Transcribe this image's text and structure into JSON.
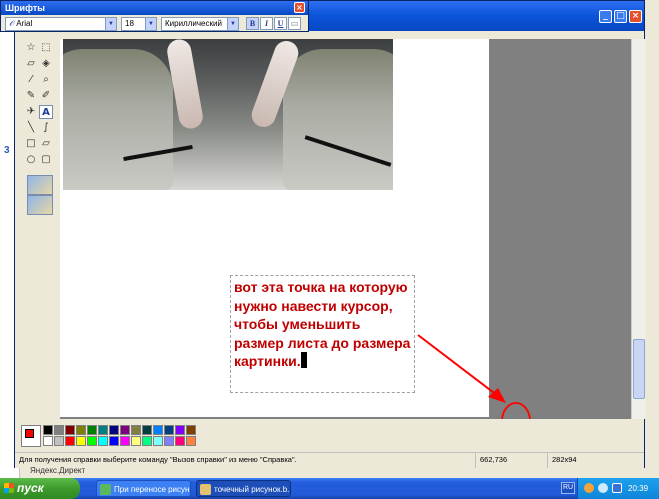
{
  "font_toolbar": {
    "title": "Шрифты",
    "font_name": "Arial",
    "font_size": "18",
    "script": "Кириллический",
    "bold_label": "B",
    "italic_label": "I",
    "underline_label": "U"
  },
  "canvas": {
    "annotation_text": "вот эта точка на которую нужно навести курсор, чтобы уменьшить размер листа до размера картинки.",
    "annotation_color": "#c00000",
    "arrow_color": "#ff0000"
  },
  "palette": {
    "foreground": "#ff0000",
    "background": "#ffffff",
    "colors": [
      "#000000",
      "#808080",
      "#800000",
      "#808000",
      "#008000",
      "#008080",
      "#000080",
      "#800080",
      "#808040",
      "#004040",
      "#0080ff",
      "#004080",
      "#8000ff",
      "#804000",
      "#ffffff",
      "#c0c0c0",
      "#ff0000",
      "#ffff00",
      "#00ff00",
      "#00ffff",
      "#0000ff",
      "#ff00ff",
      "#ffff80",
      "#00ff80",
      "#80ffff",
      "#8080ff",
      "#ff0080",
      "#ff8040"
    ]
  },
  "statusbar": {
    "help": "Для получения справки выберите команду \"Вызов справки\" из меню \"Справка\".",
    "cursor": "662,736",
    "size": "282x94"
  },
  "background_window": {
    "left_marker": "3",
    "bottom_text": "Яндекс.Директ"
  },
  "taskbar": {
    "start_label": "пуск",
    "tasks": [
      {
        "label": "При переносе рисун...",
        "icon_color": "#5cb85c"
      },
      {
        "label": "точечный рисунок.b...",
        "icon_color": "#e3c16f"
      }
    ],
    "lang": "RU",
    "clock": "20:39"
  }
}
